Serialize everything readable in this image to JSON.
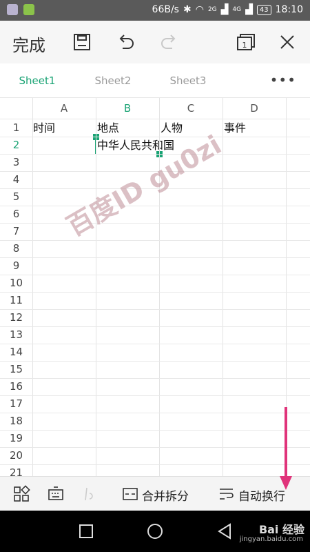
{
  "status_bar": {
    "network_speed": "66B/s",
    "signal_2g": "2G",
    "signal_4g": "4G",
    "battery": "43",
    "time": "18:10"
  },
  "toolbar": {
    "done_label": "完成"
  },
  "sheet_tabs": {
    "tabs": [
      "Sheet1",
      "Sheet2",
      "Sheet3"
    ],
    "active": "Sheet1",
    "more": "•••"
  },
  "grid": {
    "columns": [
      "A",
      "B",
      "C",
      "D"
    ],
    "active_column": "B",
    "rows": [
      "1",
      "2",
      "3",
      "4",
      "5",
      "6",
      "7",
      "8",
      "9",
      "10",
      "11",
      "12",
      "13",
      "14",
      "15",
      "16",
      "17",
      "18",
      "19",
      "20",
      "21"
    ],
    "active_row": "2",
    "cells": {
      "A1": "时间",
      "B1": "地点",
      "C1": "人物",
      "D1": "事件",
      "B2": "中华人民共和国"
    }
  },
  "watermark": "百度ID gu0zi",
  "bottom_toolbar": {
    "merge_split_label": "合并拆分",
    "auto_wrap_label": "自动换行"
  },
  "annotation_color": "#e0337a",
  "accent_color": "#1aa374",
  "footer_brand": {
    "logo_text": "Bai 经验",
    "url": "jingyan.baidu.com"
  }
}
